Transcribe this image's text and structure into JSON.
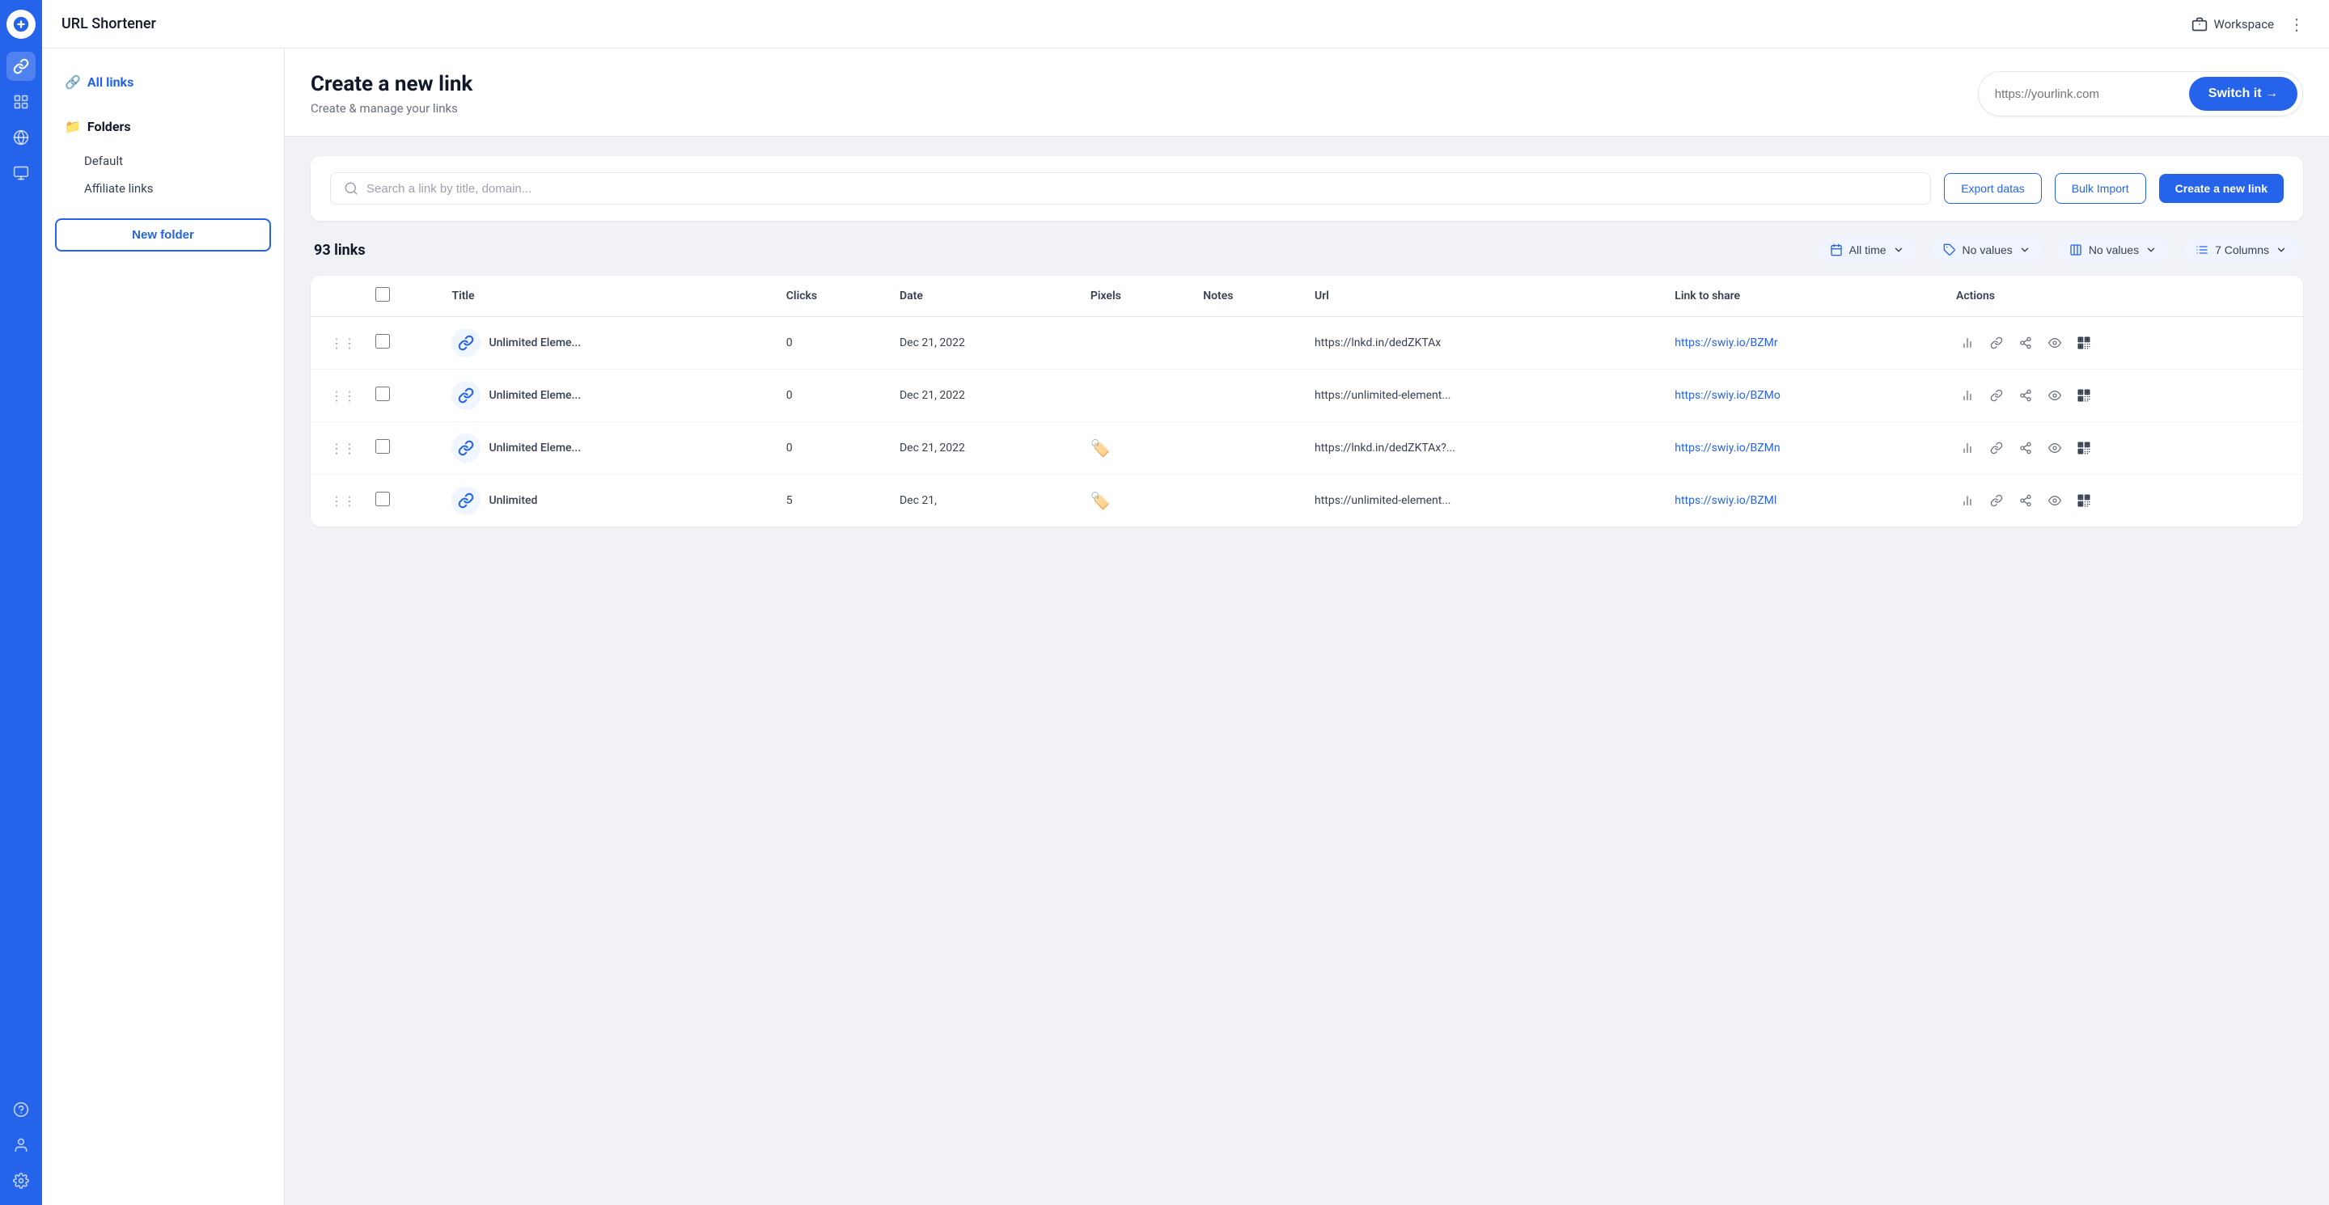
{
  "app": {
    "title": "URL Shortener"
  },
  "topbar": {
    "title": "URL Shortener",
    "workspace_label": "Workspace",
    "more_icon": "⋮"
  },
  "sidebar": {
    "all_links_label": "All links",
    "folders_label": "Folders",
    "folder_items": [
      "Default",
      "Affiliate links"
    ],
    "new_folder_label": "New folder"
  },
  "panel": {
    "heading": "Create a new link",
    "subheading": "Create & manage your links",
    "url_placeholder": "https://yourlink.com",
    "switch_it_label": "Switch it →"
  },
  "toolbar": {
    "search_placeholder": "Search a link by title, domain...",
    "export_label": "Export datas",
    "bulk_import_label": "Bulk Import",
    "create_link_label": "Create a new link"
  },
  "filters": {
    "links_count": "93 links",
    "all_time_label": "All time",
    "no_values_label_1": "No values",
    "no_values_label_2": "No values",
    "columns_label": "7 Columns"
  },
  "table": {
    "columns": [
      "Title",
      "Clicks",
      "Date",
      "Pixels",
      "Notes",
      "Url",
      "Link to share",
      "Actions"
    ],
    "rows": [
      {
        "id": 1,
        "title": "Unlimited Eleme...",
        "clicks": "0",
        "date": "Dec 21, 2022",
        "pixels": "",
        "notes": "",
        "url": "https://lnkd.in/dedZKTAx",
        "link_to_share": "https://swiy.io/BZMr",
        "has_flag": false
      },
      {
        "id": 2,
        "title": "Unlimited Eleme...",
        "clicks": "0",
        "date": "Dec 21, 2022",
        "pixels": "",
        "notes": "",
        "url": "https://unlimited-element...",
        "link_to_share": "https://swiy.io/BZMo",
        "has_flag": false
      },
      {
        "id": 3,
        "title": "Unlimited Eleme...",
        "clicks": "0",
        "date": "Dec 21, 2022",
        "pixels": "🏷️",
        "notes": "",
        "url": "https://lnkd.in/dedZKTAx?...",
        "link_to_share": "https://swiy.io/BZMn",
        "has_flag": true
      },
      {
        "id": 4,
        "title": "Unlimited",
        "clicks": "5",
        "date": "Dec 21,",
        "pixels": "🏷️",
        "notes": "",
        "url": "https://unlimited-element...",
        "link_to_share": "https://swiy.io/BZMl",
        "has_flag": true,
        "partial": true
      }
    ]
  },
  "nav_icons": [
    {
      "name": "link-icon",
      "glyph": "🔗",
      "active": true
    },
    {
      "name": "layers-icon",
      "glyph": "📄",
      "active": false
    },
    {
      "name": "globe-icon",
      "glyph": "🌐",
      "active": false
    },
    {
      "name": "monitor-icon",
      "glyph": "🖥",
      "active": false
    },
    {
      "name": "help-icon",
      "glyph": "❓",
      "active": false
    },
    {
      "name": "person-icon",
      "glyph": "👤",
      "active": false
    },
    {
      "name": "settings-icon",
      "glyph": "⚙",
      "active": false
    }
  ],
  "colors": {
    "primary": "#2563eb",
    "primary_light": "#eff6ff",
    "text_main": "#111827",
    "text_secondary": "#6b7280",
    "border": "#e5e7eb"
  }
}
